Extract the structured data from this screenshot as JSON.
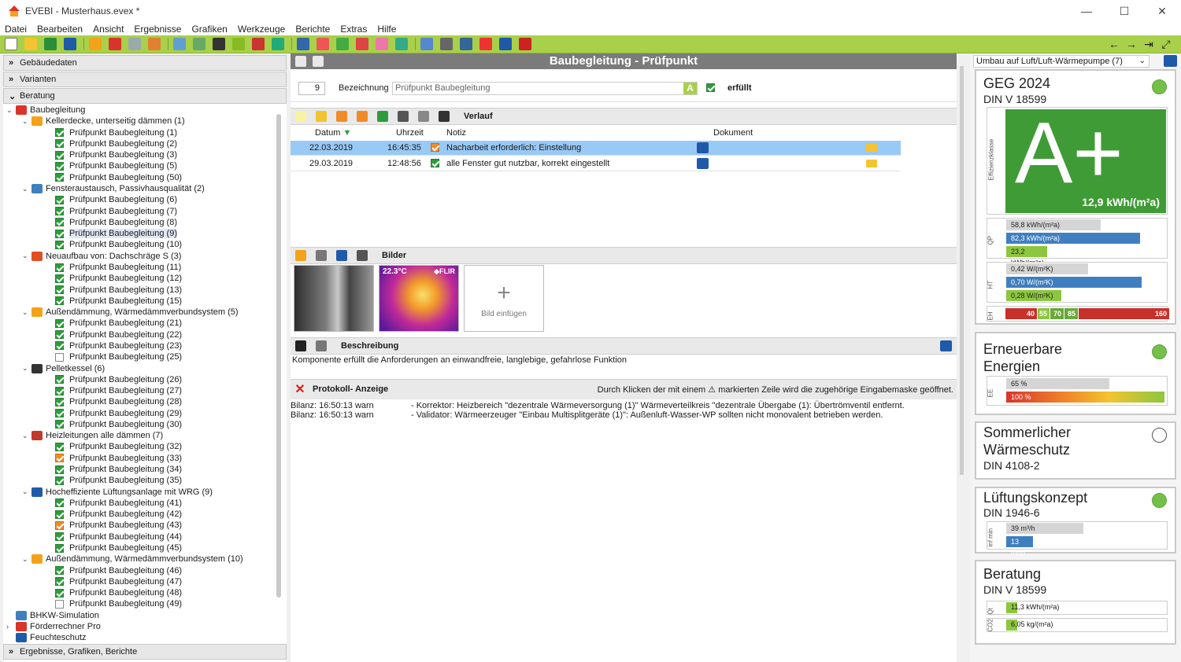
{
  "window": {
    "title": "EVEBI - Musterhaus.evex *",
    "min": "—",
    "max": "☐",
    "close": "✕"
  },
  "menu": [
    "Datei",
    "Bearbeiten",
    "Ansicht",
    "Ergebnisse",
    "Grafiken",
    "Werkzeuge",
    "Berichte",
    "Extras",
    "Hilfe"
  ],
  "toolbar_colors": [
    "#ffffff",
    "#f3c430",
    "#2a8f3a",
    "#1f5aa8",
    "#f3a21a",
    "#d9342b",
    "#9aa",
    "#e08030",
    "#60a0d0",
    "#6a6",
    "#333",
    "#8b2",
    "#c33",
    "#2a7",
    "#36a",
    "#e55",
    "#4a4",
    "#d44",
    "#e7a",
    "#3a8",
    "#58c",
    "#666",
    "#369",
    "#e33",
    "#1f5aa8",
    "#c22"
  ],
  "toolbar_right": [
    "←",
    "→",
    "⇥",
    "⤢"
  ],
  "left": {
    "sections_top": [
      {
        "label": "Gebäudedaten"
      },
      {
        "label": "Varianten"
      },
      {
        "label": "Beratung"
      }
    ],
    "tree": [
      {
        "level": 0,
        "exp": "⌄",
        "icon": "#d9342b",
        "label": "Baubegleitung"
      },
      {
        "level": 1,
        "exp": "⌄",
        "icon": "#f3a21a",
        "label": "Kellerdecke, unterseitig dämmen (1)"
      },
      {
        "level": 2,
        "cb": "green",
        "label": "Prüfpunkt Baubegleitung (1)"
      },
      {
        "level": 2,
        "cb": "green",
        "label": "Prüfpunkt Baubegleitung (2)"
      },
      {
        "level": 2,
        "cb": "green",
        "label": "Prüfpunkt Baubegleitung (3)"
      },
      {
        "level": 2,
        "cb": "green",
        "label": "Prüfpunkt Baubegleitung (5)"
      },
      {
        "level": 2,
        "cb": "green",
        "label": "Prüfpunkt Baubegleitung (50)"
      },
      {
        "level": 1,
        "exp": "⌄",
        "icon": "#3f7fc0",
        "label": "Fensteraustausch, Passivhausqualität (2)"
      },
      {
        "level": 2,
        "cb": "green",
        "label": "Prüfpunkt Baubegleitung (6)"
      },
      {
        "level": 2,
        "cb": "green",
        "label": "Prüfpunkt Baubegleitung (7)"
      },
      {
        "level": 2,
        "cb": "green",
        "label": "Prüfpunkt Baubegleitung (8)"
      },
      {
        "level": 2,
        "cb": "green",
        "label": "Prüfpunkt Baubegleitung (9)",
        "selected": true
      },
      {
        "level": 2,
        "cb": "green",
        "label": "Prüfpunkt Baubegleitung (10)"
      },
      {
        "level": 1,
        "exp": "⌄",
        "icon": "#e05020",
        "label": "Neuaufbau von: Dachschräge S (3)"
      },
      {
        "level": 2,
        "cb": "green",
        "label": "Prüfpunkt Baubegleitung (11)"
      },
      {
        "level": 2,
        "cb": "green",
        "label": "Prüfpunkt Baubegleitung (12)"
      },
      {
        "level": 2,
        "cb": "green",
        "label": "Prüfpunkt Baubegleitung (13)"
      },
      {
        "level": 2,
        "cb": "green",
        "label": "Prüfpunkt Baubegleitung (15)"
      },
      {
        "level": 1,
        "exp": "⌄",
        "icon": "#f3a21a",
        "label": "Außendämmung, Wärmedämmverbundsystem (5)"
      },
      {
        "level": 2,
        "cb": "green",
        "label": "Prüfpunkt Baubegleitung (21)"
      },
      {
        "level": 2,
        "cb": "green",
        "label": "Prüfpunkt Baubegleitung (22)"
      },
      {
        "level": 2,
        "cb": "green",
        "label": "Prüfpunkt Baubegleitung (23)"
      },
      {
        "level": 2,
        "cb": "empty",
        "label": "Prüfpunkt Baubegleitung (25)"
      },
      {
        "level": 1,
        "exp": "⌄",
        "icon": "#333333",
        "label": "Pelletkessel (6)"
      },
      {
        "level": 2,
        "cb": "green",
        "label": "Prüfpunkt Baubegleitung (26)"
      },
      {
        "level": 2,
        "cb": "green",
        "label": "Prüfpunkt Baubegleitung (27)"
      },
      {
        "level": 2,
        "cb": "green",
        "label": "Prüfpunkt Baubegleitung (28)"
      },
      {
        "level": 2,
        "cb": "green",
        "label": "Prüfpunkt Baubegleitung (29)"
      },
      {
        "level": 2,
        "cb": "green",
        "label": "Prüfpunkt Baubegleitung (30)"
      },
      {
        "level": 1,
        "exp": "⌄",
        "icon": "#c0392b",
        "label": "Heizleitungen alle dämmen (7)"
      },
      {
        "level": 2,
        "cb": "green",
        "label": "Prüfpunkt Baubegleitung (32)"
      },
      {
        "level": 2,
        "cb": "orange",
        "label": "Prüfpunkt Baubegleitung (33)"
      },
      {
        "level": 2,
        "cb": "green",
        "label": "Prüfpunkt Baubegleitung (34)"
      },
      {
        "level": 2,
        "cb": "green",
        "label": "Prüfpunkt Baubegleitung (35)"
      },
      {
        "level": 1,
        "exp": "⌄",
        "icon": "#1f5aa8",
        "label": "Hocheffiziente Lüftungsanlage mit WRG (9)"
      },
      {
        "level": 2,
        "cb": "green",
        "label": "Prüfpunkt Baubegleitung (41)"
      },
      {
        "level": 2,
        "cb": "green",
        "label": "Prüfpunkt Baubegleitung (42)"
      },
      {
        "level": 2,
        "cb": "orange",
        "label": "Prüfpunkt Baubegleitung (43)"
      },
      {
        "level": 2,
        "cb": "green",
        "label": "Prüfpunkt Baubegleitung (44)"
      },
      {
        "level": 2,
        "cb": "green",
        "label": "Prüfpunkt Baubegleitung (45)"
      },
      {
        "level": 1,
        "exp": "⌄",
        "icon": "#f3a21a",
        "label": "Außendämmung, Wärmedämmverbundsystem (10)"
      },
      {
        "level": 2,
        "cb": "green",
        "label": "Prüfpunkt Baubegleitung (46)"
      },
      {
        "level": 2,
        "cb": "green",
        "label": "Prüfpunkt Baubegleitung (47)"
      },
      {
        "level": 2,
        "cb": "green",
        "label": "Prüfpunkt Baubegleitung (48)"
      },
      {
        "level": 2,
        "cb": "empty",
        "label": "Prüfpunkt Baubegleitung (49)"
      },
      {
        "level": 0,
        "exp": "",
        "icon": "#3f7fc0",
        "label": "BHKW-Simulation"
      },
      {
        "level": 0,
        "exp": "›",
        "icon": "#d9342b",
        "label": "Förderrechner Pro"
      },
      {
        "level": 0,
        "exp": "",
        "icon": "#1f5aa8",
        "label": "Feuchteschutz"
      }
    ],
    "bottom_section": "Ergebnisse, Grafiken, Berichte"
  },
  "center": {
    "title": "Baubegleitung - Prüfpunkt",
    "number": "9",
    "bezeichnung_label": "Bezeichnung",
    "bezeichnung_value": "Prüfpunkt Baubegleitung",
    "a_badge": "A",
    "erfuellt": "erfüllt",
    "verlauf": {
      "title": "Verlauf",
      "icon_colors": [
        "#f7f3a0",
        "#f3c430",
        "#f08b2a",
        "#f08b2a",
        "#2e9c3c",
        "#555",
        "#888",
        "#333"
      ],
      "headers": {
        "datum": "Datum",
        "uhrzeit": "Uhrzeit",
        "notiz": "Notiz",
        "dokument": "Dokument"
      },
      "rows": [
        {
          "datum": "22.03.2019",
          "uhrzeit": "16:45:35",
          "cb": "orange",
          "notiz": "Nacharbeit erforderlich: Einstellung",
          "selected": true
        },
        {
          "datum": "29.03.2019",
          "uhrzeit": "12:48:56",
          "cb": "green",
          "notiz": "alle Fenster gut nutzbar, korrekt eingestellt",
          "selected": false
        }
      ]
    },
    "bilder": {
      "title": "Bilder",
      "thermal_temp": "22.3°C",
      "thermal_brand": "◆FLIR",
      "add_label": "Bild einfügen",
      "plus": "+"
    },
    "beschreibung": {
      "title": "Beschreibung",
      "text": "Komponente erfüllt die Anforderungen an einwandfreie, langlebige, gefahrlose Funktion"
    },
    "protokoll": {
      "title": "Protokoll- Anzeige",
      "hint": "Durch Klicken der mit einem ⚠ markierten Zeile wird die zugehörige Eingabemaske geöffnet.",
      "lines": [
        {
          "a": "Bilanz: 16:50:13 warn",
          "b": "-   Korrektor: Heizbereich \"dezentrale Wärmeversorgung (1)\" Wärmeverteilkreis \"dezentrale Übergabe (1): Übertrömventil entfernt."
        },
        {
          "a": "Bilanz: 16:50:13 warn",
          "b": "-   Validator: Wärmeerzeuger \"Einbau Multisplitgeräte (1)\": Außenluft-Wasser-WP sollten nicht monovalent betrieben werden."
        }
      ]
    }
  },
  "right": {
    "variant": "Umbau auf Luft/Luft-Wärmepumpe (7)",
    "geg": {
      "title": "GEG 2024",
      "sub": "DIN V 18599",
      "class_label": "Effizienzklasse",
      "class": "A+",
      "value": "12,9 kWh/(m²a)",
      "qp_label": "QP",
      "qp": [
        {
          "label": "58,8 kWh/(m²a)",
          "frac": 0.53,
          "color": "gray"
        },
        {
          "label": "82,3 kWh/(m²a)",
          "frac": 0.75,
          "color": "blue"
        },
        {
          "label": "23,2 kWh/(m²a)",
          "frac": 0.23,
          "color": "green"
        }
      ],
      "ht_label": "HT",
      "ht": [
        {
          "label": "0,42 W/(m²K)",
          "frac": 0.46,
          "color": "gray"
        },
        {
          "label": "0,70 W/(m²K)",
          "frac": 0.76,
          "color": "blue"
        },
        {
          "label": "0,28 W/(m²K)",
          "frac": 0.31,
          "color": "green"
        }
      ],
      "eh_label": "EH",
      "eh": [
        "40",
        "55",
        "70",
        "85",
        "160"
      ]
    },
    "ee": {
      "title1": "Erneuerbare",
      "title2": "Energien",
      "label": "EE",
      "bars": [
        {
          "label": "65 %",
          "frac": 0.65
        },
        {
          "label": "100 %",
          "frac": 1.0
        }
      ]
    },
    "sw": {
      "title1": "Sommerlicher",
      "title2": "Wärmeschutz",
      "sub": "DIN 4108-2"
    },
    "lk": {
      "title": "Lüftungskonzept",
      "sub": "DIN 1946-6",
      "label": "inf min",
      "bars": [
        {
          "label": "39 m³/h",
          "frac": 0.49,
          "color": "gray"
        },
        {
          "label": "13 m³/h",
          "frac": 0.17,
          "color": "blue"
        }
      ]
    },
    "ber": {
      "title": "Beratung",
      "sub": "DIN V 18599",
      "q_label": "Qt",
      "q": "11,3 kWh/(m²a)",
      "co2_label": "CO2",
      "co2": "6,05 kg/(m²a)"
    }
  }
}
